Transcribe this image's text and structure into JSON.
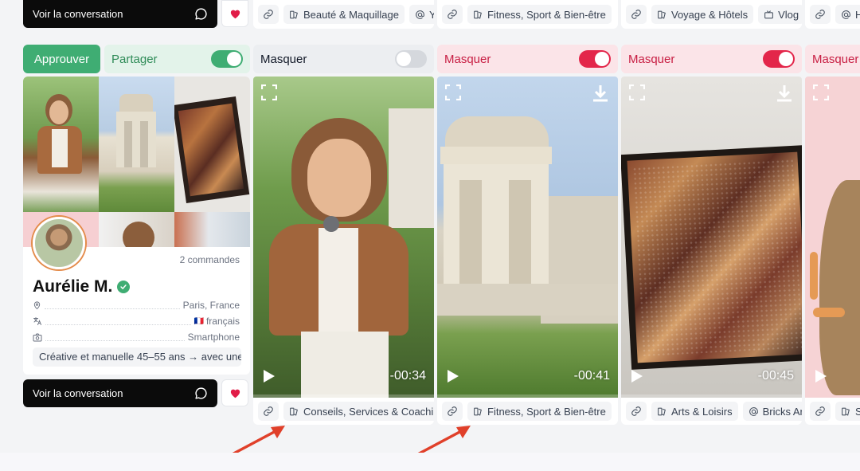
{
  "top_row": {
    "conversation_label": "Voir la conversation",
    "cards": [
      {
        "tags": [
          "Beauté & Maquillage",
          "Yv"
        ]
      },
      {
        "tags": [
          "Fitness, Sport & Bien-être"
        ]
      },
      {
        "tags": [
          "Voyage & Hôtels",
          "Vlog"
        ]
      },
      {
        "tags": [
          "He"
        ]
      }
    ]
  },
  "actions": {
    "approve_label": "Approuver",
    "share_label": "Partager"
  },
  "profile": {
    "orders": "2 commandes",
    "name": "Aurélie M.",
    "location": "Paris, France",
    "language": "français",
    "language_flag": "🇫🇷",
    "device": "Smartphone",
    "bio": "Créative et manuelle 45–55 ans → avec une",
    "conversation_label": "Voir la conversation"
  },
  "videos": [
    {
      "mask_label": "Masquer",
      "masked": false,
      "duration": "-00:34",
      "tags": [
        "Conseils, Services & Coaching"
      ]
    },
    {
      "mask_label": "Masquer",
      "masked": true,
      "duration": "-00:41",
      "tags": [
        "Fitness, Sport & Bien-être"
      ]
    },
    {
      "mask_label": "Masquer",
      "masked": true,
      "duration": "-00:45",
      "tags": [
        "Arts & Loisirs",
        "Bricks Art"
      ]
    },
    {
      "mask_label": "Masquer",
      "masked": true,
      "duration": "",
      "tags": [
        "Sa"
      ]
    }
  ],
  "colors": {
    "approve_green": "#3fad73",
    "share_bg": "#e3f3ea",
    "mask_on_bg": "#fbe4e8",
    "mask_on_text": "#c81e43",
    "toggle_red": "#e3264a",
    "heart_red": "#e11d48",
    "arrow_red": "#e0402a"
  }
}
